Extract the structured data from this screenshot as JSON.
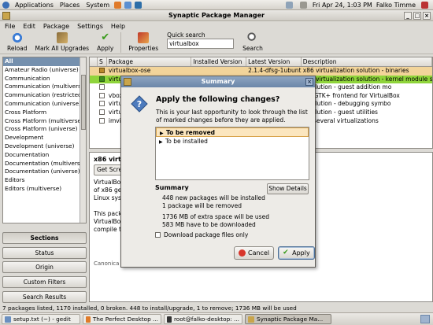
{
  "panel": {
    "menus": [
      "Applications",
      "Places",
      "System"
    ],
    "clock": "Fri Apr 24,  1:03 PM",
    "user": "Falko Timme"
  },
  "window": {
    "title": "Synaptic Package Manager"
  },
  "menubar": [
    "File",
    "Edit",
    "Package",
    "Settings",
    "Help"
  ],
  "toolbar": {
    "reload": "Reload",
    "mark_all": "Mark All Upgrades",
    "apply": "Apply",
    "properties": "Properties",
    "quick_search_label": "Quick search",
    "quick_search_value": "virtualbox",
    "search": "Search"
  },
  "sections": [
    "All",
    "Amateur Radio (universe)",
    "Communication",
    "Communication (multiverse)",
    "Communication (restricted)",
    "Communication (universe)",
    "Cross Platform",
    "Cross Platform (multiverse)",
    "Cross Platform (universe)",
    "Development",
    "Development (universe)",
    "Documentation",
    "Documentation (multiverse)",
    "Documentation (universe)",
    "Editors",
    "Editors (multiverse)"
  ],
  "filters": {
    "sections": "Sections",
    "status": "Status",
    "origin": "Origin",
    "custom": "Custom Filters",
    "results": "Search Results"
  },
  "pkg_headers": [
    "S",
    "Package",
    "Installed Version",
    "Latest Version",
    "Description"
  ],
  "packages": [
    {
      "name": "virtualbox-ose",
      "installed": "",
      "latest": "2.1.4-dfsg-1ubuntu",
      "desc": "x86 virtualization solution - binaries"
    },
    {
      "name": "virtu",
      "installed": "",
      "latest": "",
      "desc": "x86 virtualization solution - kernel module sou"
    },
    {
      "name": "",
      "installed": "",
      "latest": "",
      "desc": "n solution - guest addition mo"
    },
    {
      "name": "vbox",
      "installed": "",
      "latest": "",
      "desc": "ple GTK+ frontend for VirtualBox"
    },
    {
      "name": "virtu",
      "installed": "",
      "latest": "",
      "desc": "n solution - debugging symbo"
    },
    {
      "name": "virtu",
      "installed": "",
      "latest": "",
      "desc": "n solution - guest utilities"
    },
    {
      "name": "imvi",
      "installed": "",
      "latest": "",
      "desc": "cts several virtualizations"
    }
  ],
  "details": {
    "title": "x86 virt",
    "button": "Get Scre",
    "lines": [
      "VirtualBo",
      "of x86 ge",
      "Linux sys",
      "",
      "This pack",
      "VirtualBo",
      "compile t"
    ],
    "community": "Canonica                                                                   be provided by the Ubuntu community."
  },
  "statusbar": "7 packages listed, 1170 installed, 0 broken. 448 to install/upgrade, 1 to remove; 1736 MB will be used",
  "taskbar": [
    {
      "label": "setup.txt (~) - gedit"
    },
    {
      "label": "The Perfect Desktop ..."
    },
    {
      "label": "root@falko-desktop: ..."
    },
    {
      "label": "Synaptic Package Ma..."
    }
  ],
  "dialog": {
    "title": "Summary",
    "heading": "Apply the following changes?",
    "description": "This is your last opportunity to look through the list of marked changes before they are applied.",
    "changes": [
      "To be removed",
      "To be installed"
    ],
    "summary_label": "Summary",
    "show_details": "Show Details",
    "summary_lines": [
      "448 new packages will be installed",
      "1 package will be removed",
      "1736 MB of extra space will be used",
      "583 MB have to be downloaded"
    ],
    "download_only": "Download package files only",
    "cancel": "Cancel",
    "apply": "Apply"
  }
}
